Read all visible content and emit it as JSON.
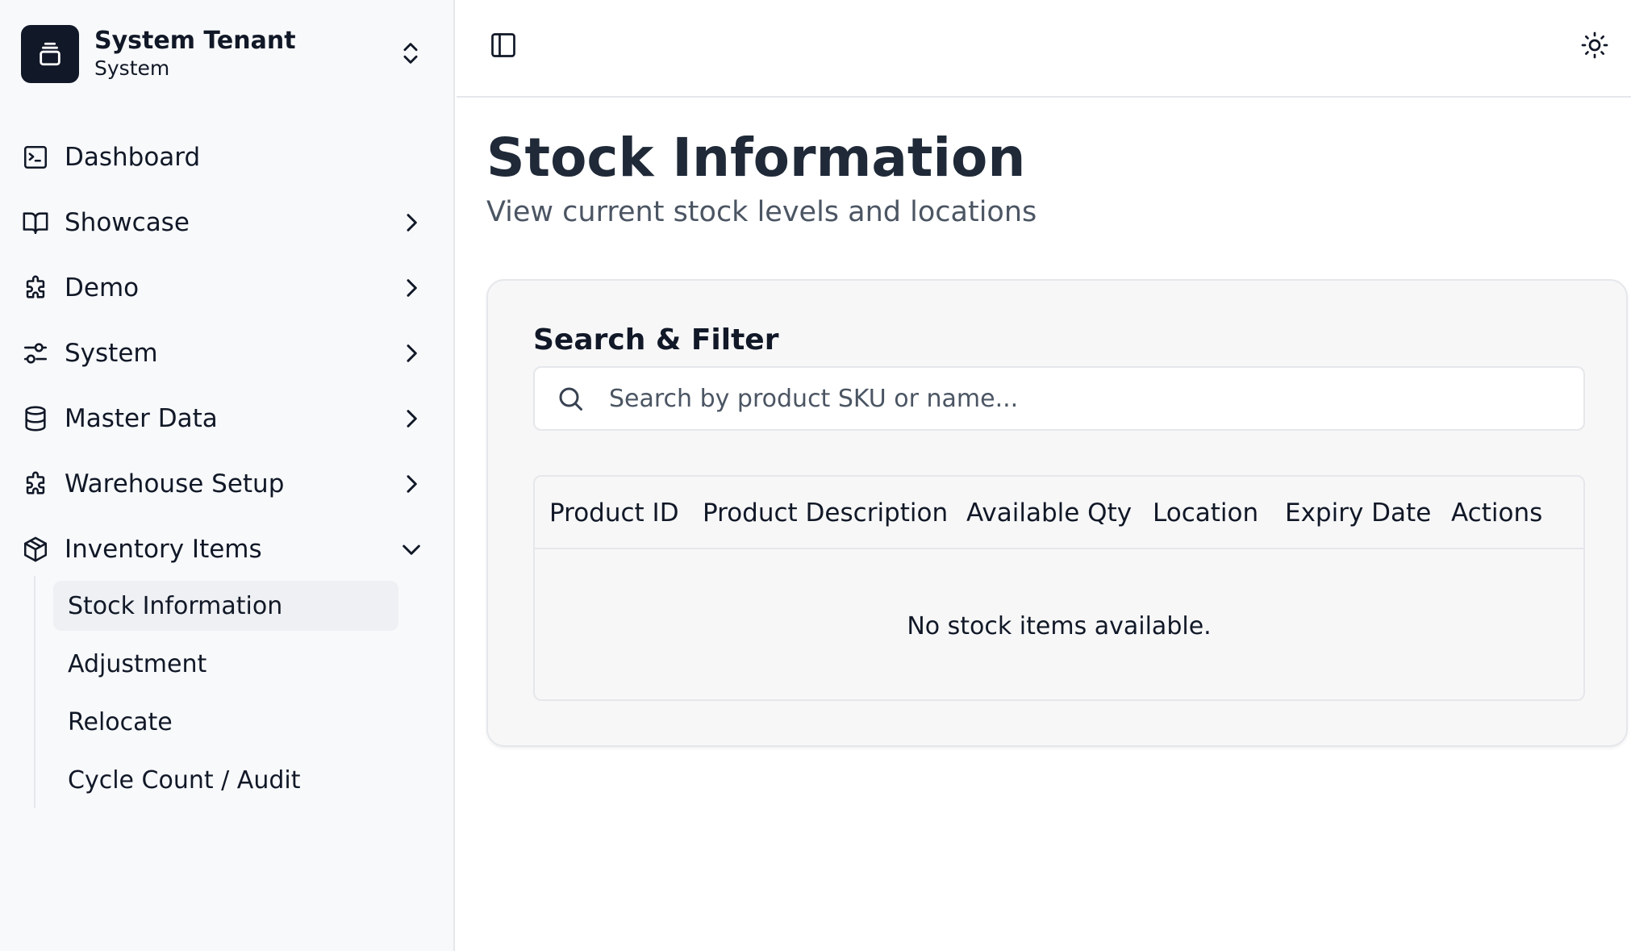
{
  "tenant": {
    "name": "System Tenant",
    "subtitle": "System"
  },
  "sidebar": {
    "items": [
      {
        "label": "Dashboard",
        "icon": "terminal-square-icon"
      },
      {
        "label": "Showcase",
        "icon": "book-open-icon"
      },
      {
        "label": "Demo",
        "icon": "puzzle-icon"
      },
      {
        "label": "System",
        "icon": "settings-sliders-icon"
      },
      {
        "label": "Master Data",
        "icon": "database-icon"
      },
      {
        "label": "Warehouse Setup",
        "icon": "puzzle-icon"
      },
      {
        "label": "Inventory Items",
        "icon": "package-icon",
        "expanded": true
      }
    ],
    "subitems": [
      {
        "label": "Stock Information",
        "active": true
      },
      {
        "label": "Adjustment"
      },
      {
        "label": "Relocate"
      },
      {
        "label": "Cycle Count / Audit"
      }
    ]
  },
  "header": {
    "toggle_icon": "sidebar-toggle-icon",
    "theme_icon": "sun-icon"
  },
  "page": {
    "title": "Stock Information",
    "subtitle": "View current stock levels and locations"
  },
  "filter": {
    "title": "Search & Filter",
    "search_placeholder": "Search by product SKU or name...",
    "search_value": ""
  },
  "table": {
    "columns": [
      "Product ID",
      "Product Description",
      "Available Qty",
      "Location",
      "Expiry Date",
      "Actions"
    ],
    "rows": [],
    "empty_message": "No stock items available."
  },
  "colors": {
    "sidebar_bg": "#f8f9fb",
    "logo_bg": "#111827",
    "active_item_bg": "#eef0f3",
    "card_bg": "#f7f7f8",
    "border": "#e5e7eb"
  }
}
